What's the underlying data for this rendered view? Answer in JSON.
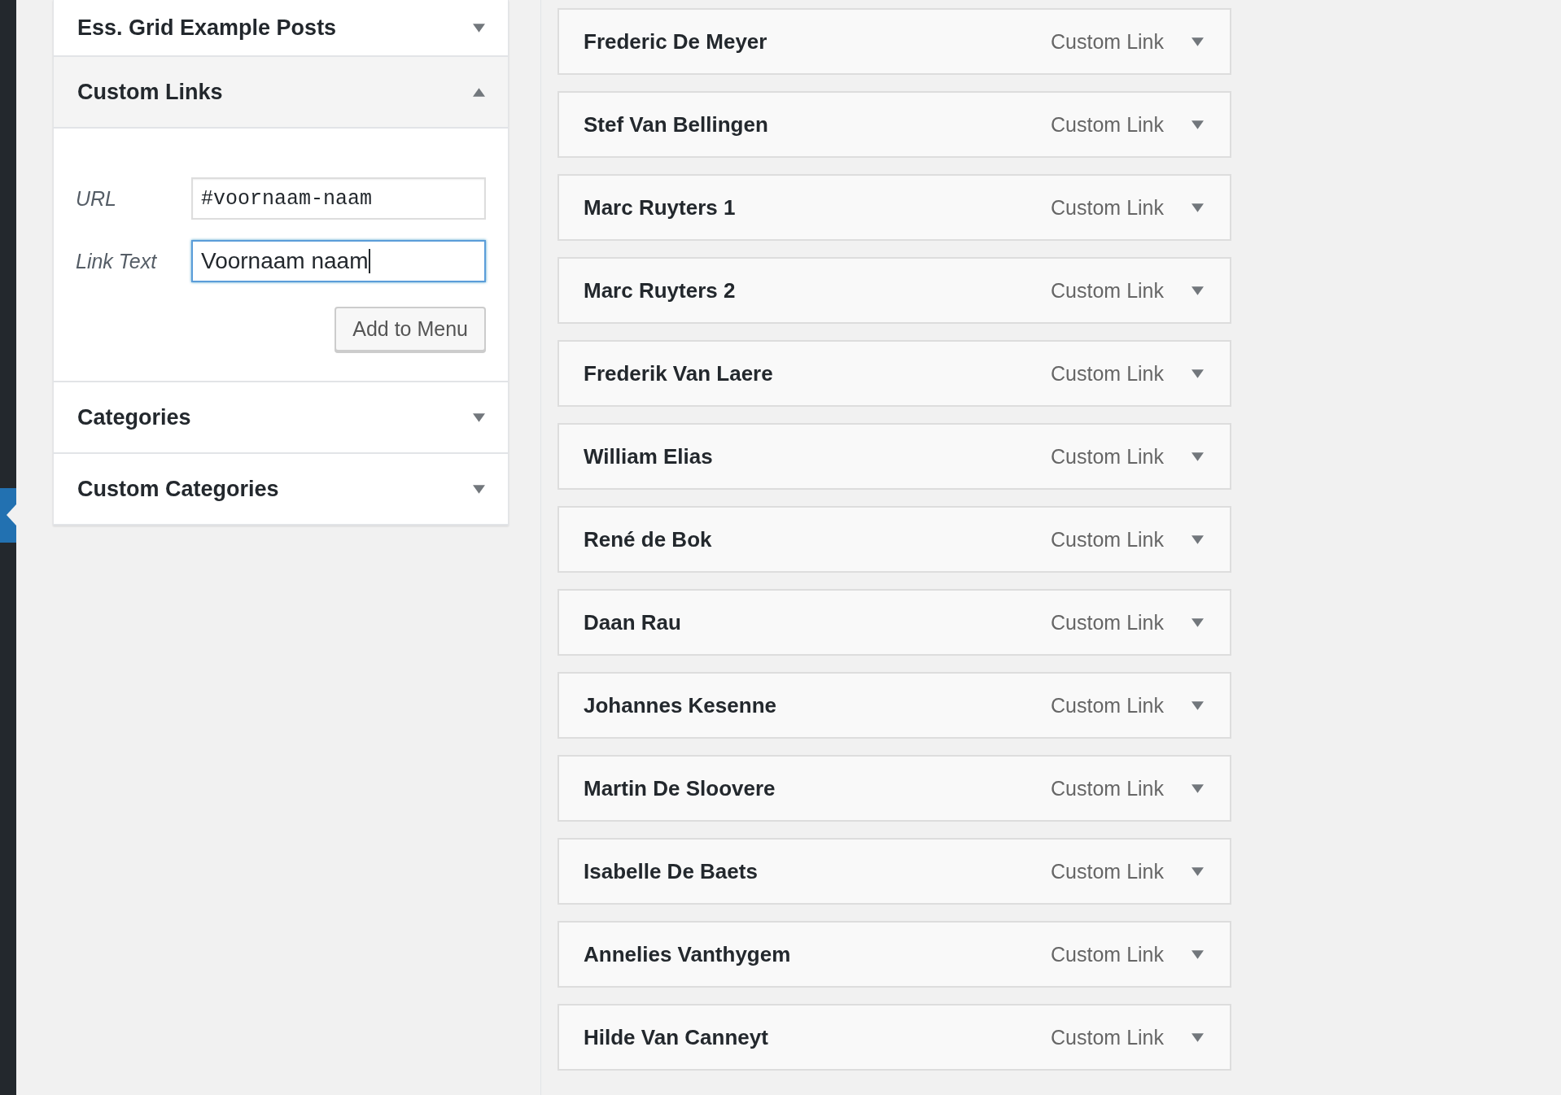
{
  "accordion": [
    {
      "title": "Ess. Grid Example Posts",
      "expanded": false
    },
    {
      "title": "Custom Links",
      "expanded": true
    },
    {
      "title": "Categories",
      "expanded": false
    },
    {
      "title": "Custom Categories",
      "expanded": false
    }
  ],
  "custom_links": {
    "url_label": "URL",
    "url_value": "#voornaam-naam",
    "text_label": "Link Text",
    "text_value": "Voornaam naam",
    "text_focused": true,
    "button": "Add to Menu"
  },
  "menu_items": [
    {
      "title": "Frederic De Meyer",
      "type": "Custom Link"
    },
    {
      "title": "Stef Van Bellingen",
      "type": "Custom Link"
    },
    {
      "title": "Marc Ruyters 1",
      "type": "Custom Link"
    },
    {
      "title": "Marc Ruyters 2",
      "type": "Custom Link"
    },
    {
      "title": "Frederik Van Laere",
      "type": "Custom Link"
    },
    {
      "title": "William Elias",
      "type": "Custom Link"
    },
    {
      "title": "René de Bok",
      "type": "Custom Link"
    },
    {
      "title": "Daan Rau",
      "type": "Custom Link"
    },
    {
      "title": "Johannes Kesenne",
      "type": "Custom Link"
    },
    {
      "title": "Martin De Sloovere",
      "type": "Custom Link"
    },
    {
      "title": "Isabelle De Baets",
      "type": "Custom Link"
    },
    {
      "title": "Annelies Vanthygem",
      "type": "Custom Link"
    },
    {
      "title": "Hilde Van Canneyt",
      "type": "Custom Link"
    }
  ]
}
